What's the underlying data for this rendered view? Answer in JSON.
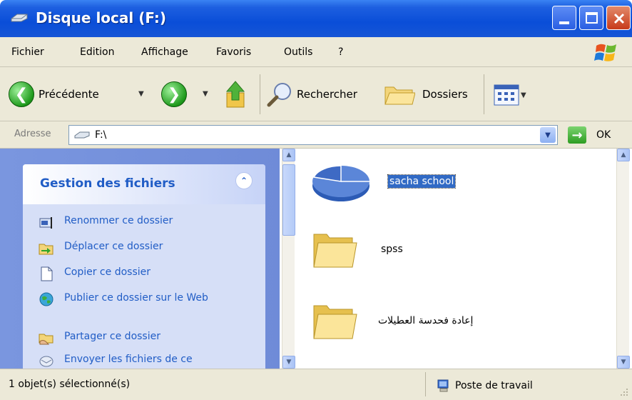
{
  "window": {
    "title": "Disque local (F:)"
  },
  "menu": {
    "items": [
      "Fichier",
      "Edition",
      "Affichage",
      "Favoris",
      "Outils",
      "?"
    ]
  },
  "toolbar": {
    "back_label": "Précédente",
    "search_label": "Rechercher",
    "folders_label": "Dossiers"
  },
  "address": {
    "label": "Adresse",
    "value": "F:\\",
    "go_label": "OK"
  },
  "task_pane": {
    "title": "Gestion des fichiers",
    "tasks": [
      "Renommer ce dossier",
      "Déplacer ce dossier",
      "Copier ce dossier",
      "Publier ce dossier sur le Web",
      "Partager ce dossier",
      "Envoyer les fichiers de ce"
    ]
  },
  "files": [
    {
      "name": "sacha school",
      "icon": "pie-chart-icon",
      "selected": true
    },
    {
      "name": "spss",
      "icon": "folder-icon",
      "selected": false
    },
    {
      "name": "إعادة فحدسة العطيلات",
      "icon": "folder-icon",
      "selected": false
    }
  ],
  "status": {
    "left": "1 objet(s) sélectionné(s)",
    "right": "Poste de travail"
  },
  "colors": {
    "titlebar": "#0a4ed8",
    "taskpane": "#7a96df",
    "task_link": "#215dc6",
    "selection": "#316ac5"
  }
}
